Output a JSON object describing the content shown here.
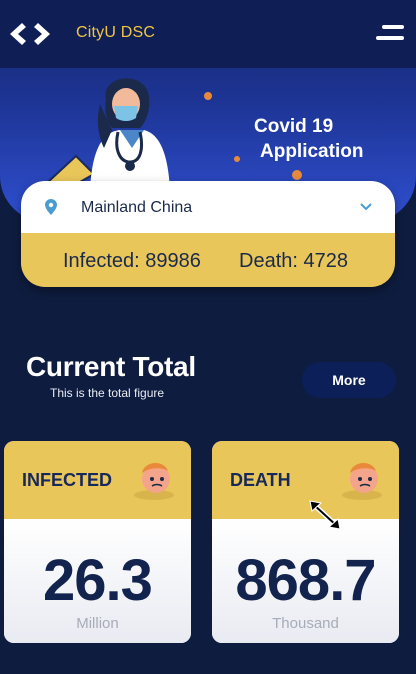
{
  "header": {
    "app_title": "CityU DSC",
    "logo_icon": "code-brackets-icon",
    "menu_icon": "hamburger-menu-icon"
  },
  "hero": {
    "title_line1": "Covid 19",
    "title_line2": "Application",
    "illustration": "doctor-with-mask-illustration"
  },
  "location": {
    "selected": "Mainland China",
    "pin_icon": "location-pin-icon",
    "dropdown_icon": "chevron-down-icon",
    "infected_text": "Infected: 89986",
    "death_text": "Death: 4728"
  },
  "current_total": {
    "title": "Current Total",
    "subtitle": "This is the total figure",
    "more_label": "More"
  },
  "cards": [
    {
      "label": "INFECTED",
      "value": "26.3",
      "unit": "Million",
      "icon": "sick-face-icon"
    },
    {
      "label": "DEATH",
      "value": "868.7",
      "unit": "Thousand",
      "icon": "sick-face-icon"
    }
  ],
  "colors": {
    "accent_yellow": "#e9c65a",
    "title_yellow": "#f1c741",
    "navy": "#0e1c3f",
    "value_navy": "#12244d"
  }
}
